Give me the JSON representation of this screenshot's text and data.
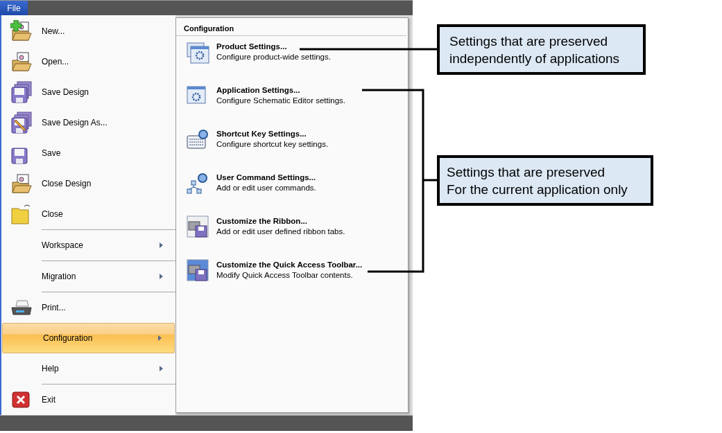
{
  "menu_bar": {
    "tab": {
      "label": "File",
      "selected": true
    }
  },
  "file_menu": {
    "items": [
      {
        "label": "New...",
        "icon": true,
        "submenu": false,
        "separator_before": false,
        "selected": false
      },
      {
        "label": "Open...",
        "icon": true,
        "submenu": false,
        "separator_before": false,
        "selected": false
      },
      {
        "label": "Save Design",
        "icon": true,
        "submenu": false,
        "separator_before": false,
        "selected": false
      },
      {
        "label": "Save Design As...",
        "icon": true,
        "submenu": false,
        "separator_before": false,
        "selected": false
      },
      {
        "label": "Save",
        "icon": true,
        "submenu": false,
        "separator_before": false,
        "selected": false
      },
      {
        "label": "Close Design",
        "icon": true,
        "submenu": false,
        "separator_before": false,
        "selected": false
      },
      {
        "label": "Close",
        "icon": true,
        "submenu": false,
        "separator_before": false,
        "selected": false
      },
      {
        "label": "Workspace",
        "icon": false,
        "submenu": true,
        "separator_before": true,
        "selected": false
      },
      {
        "label": "Migration",
        "icon": false,
        "submenu": true,
        "separator_before": true,
        "selected": false
      },
      {
        "label": "Print...",
        "icon": true,
        "submenu": false,
        "separator_before": true,
        "selected": false
      },
      {
        "label": "Configuration",
        "icon": false,
        "submenu": true,
        "separator_before": false,
        "selected": true
      },
      {
        "label": "Help",
        "icon": false,
        "submenu": true,
        "separator_before": false,
        "selected": false
      },
      {
        "label": "Exit",
        "icon": true,
        "submenu": false,
        "separator_before": true,
        "selected": false
      }
    ]
  },
  "configuration_panel": {
    "title": "Configuration",
    "items": [
      {
        "title": "Product Settings...",
        "description": "Configure product-wide settings."
      },
      {
        "title": "Application Settings...",
        "description": "Configure Schematic Editor settings."
      },
      {
        "title": "Shortcut Key Settings...",
        "description": "Configure shortcut key settings."
      },
      {
        "title": "User Command Settings...",
        "description": "Add or edit user commands."
      },
      {
        "title": "Customize the Ribbon...",
        "description": "Add or edit user defined ribbon tabs."
      },
      {
        "title": "Customize the Quick Access Toolbar...",
        "description": "Modify Quick Access Toolbar contents."
      }
    ]
  },
  "callouts": [
    {
      "lines": [
        "Settings that are preserved",
        "independently of applications"
      ]
    },
    {
      "lines": [
        "Settings that are preserved",
        "For the current application only"
      ]
    }
  ]
}
